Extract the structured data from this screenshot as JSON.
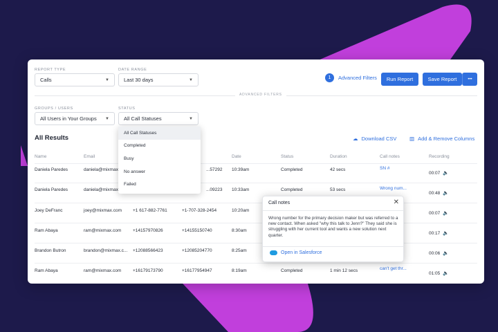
{
  "filters": {
    "report_type_label": "REPORT TYPE",
    "report_type_value": "Calls",
    "date_range_label": "DATE RANGE",
    "date_range_value": "Last 30 days",
    "groups_label": "GROUPS / USERS",
    "groups_value": "All Users in Your Groups",
    "status_label": "STATUS",
    "status_value": "All Call Statuses",
    "advanced_divider": "ADVANCED FILTERS"
  },
  "toolbar": {
    "advanced_count": "1",
    "advanced_label": "Advanced Filters",
    "run_report": "Run Report",
    "save_report": "Save Report",
    "more": "•••"
  },
  "results": {
    "title": "All Results",
    "download_csv": "Download CSV",
    "add_remove_columns": "Add & Remove Columns",
    "columns": [
      "Name",
      "Email",
      "",
      "",
      "Date",
      "Status",
      "Duration",
      "Call notes",
      "Recording"
    ],
    "rows": [
      {
        "name": "Daniela Paredes",
        "email": "daniela@mixmax...",
        "from": "",
        "to": "...57292",
        "date": "10:39am",
        "status": "Completed",
        "duration": "42 secs",
        "notes": "SN #",
        "recording": "00:07"
      },
      {
        "name": "Daniela Paredes",
        "email": "daniela@mixmax...",
        "from": "",
        "to": "...09223",
        "date": "10:33am",
        "status": "Completed",
        "duration": "53 secs",
        "notes": "Wrong num...",
        "recording": "00:48"
      },
      {
        "name": "Joey DeFranc",
        "email": "joey@mixmax.com",
        "from": "+1 617-882-7761",
        "to": "+1-707-328-2454",
        "date": "10:20am",
        "status": "",
        "duration": "",
        "notes": "",
        "recording": "00:07"
      },
      {
        "name": "Ram Abaya",
        "email": "ram@mixmax.com",
        "from": "+14157970826",
        "to": "+14155150740",
        "date": "8:30am",
        "status": "",
        "duration": "",
        "notes": "",
        "recording": "00:17"
      },
      {
        "name": "Brandon Butron",
        "email": "brandon@mixmax.c...",
        "from": "+12088566423",
        "to": "+12085204770",
        "date": "8:25am",
        "status": "",
        "duration": "",
        "notes": "",
        "recording": "00:06"
      },
      {
        "name": "Ram Abaya",
        "email": "ram@mixmax.com",
        "from": "+16179173790",
        "to": "+16177954947",
        "date": "8:19am",
        "status": "Completed",
        "duration": "1 min 12 secs",
        "notes": "can't get thr...",
        "recording": "01:05"
      }
    ]
  },
  "status_dropdown": {
    "options": [
      "All Call Statuses",
      "Completed",
      "Busy",
      "No answer",
      "Failed"
    ],
    "selected": "All Call Statuses"
  },
  "call_notes_popup": {
    "title": "Call notes",
    "close": "✕",
    "body": "Wrong number for the primary decision maker but was referred to a new contact.  When asked \"why this talk to Jenn?\" They said she is struggling with her current tool and wants a new solution next quarter.",
    "salesforce_link": "Open in Salesforce"
  },
  "colors": {
    "background": "#1d1a4b",
    "accent_shape": "#c13fdc",
    "primary": "#2f6fde"
  }
}
